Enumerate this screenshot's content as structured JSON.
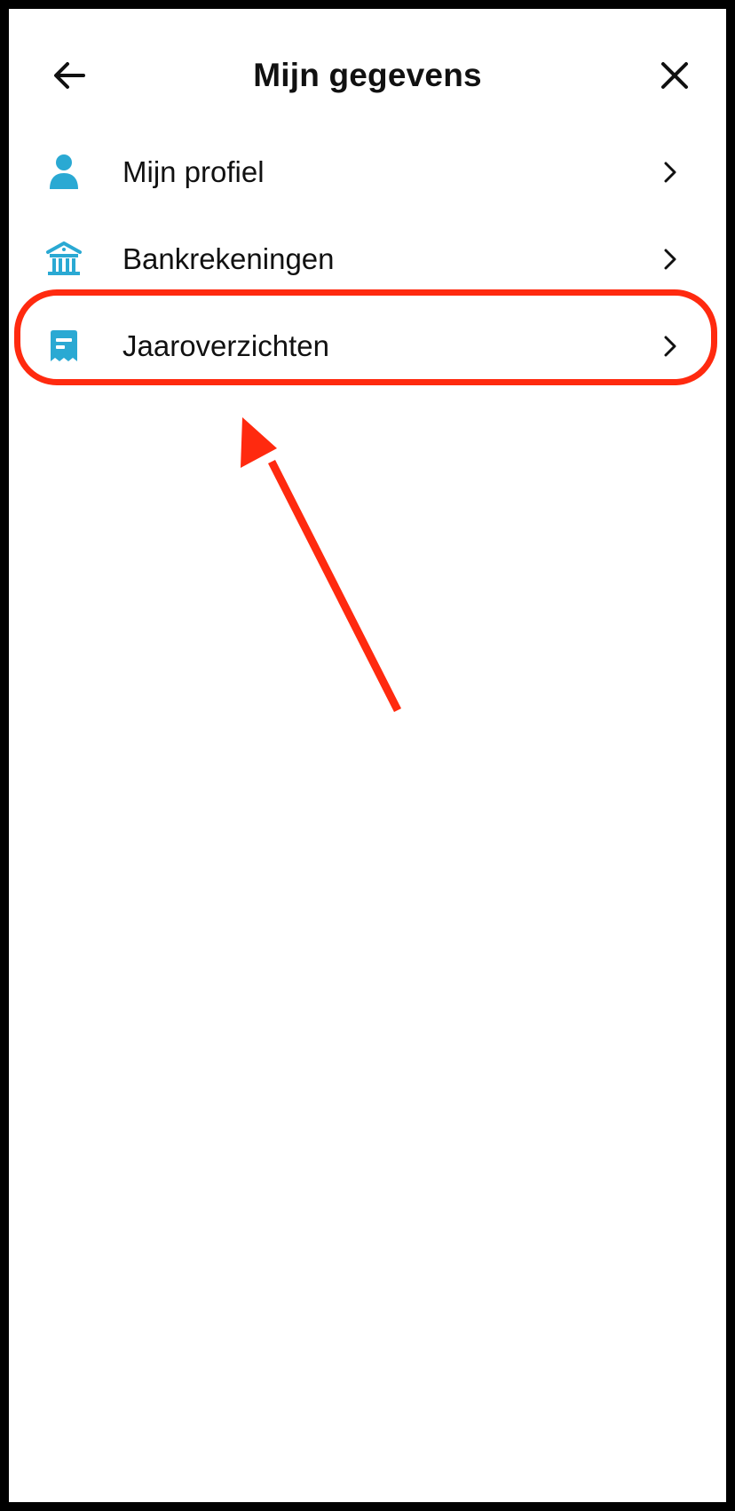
{
  "header": {
    "title": "Mijn gegevens",
    "back_icon": "arrow-left-icon",
    "close_icon": "close-icon"
  },
  "menu": {
    "items": [
      {
        "label": "Mijn profiel",
        "icon": "person-icon"
      },
      {
        "label": "Bankrekeningen",
        "icon": "bank-icon"
      },
      {
        "label": "Jaaroverzichten",
        "icon": "receipt-icon"
      }
    ],
    "chevron_icon": "chevron-right-icon"
  },
  "annotation": {
    "highlighted_item": "Jaaroverzichten",
    "highlight_color": "#ff2a0f"
  },
  "colors": {
    "icon_accent": "#2aa9d3",
    "text": "#111111",
    "background": "#ffffff",
    "frame": "#000000"
  }
}
